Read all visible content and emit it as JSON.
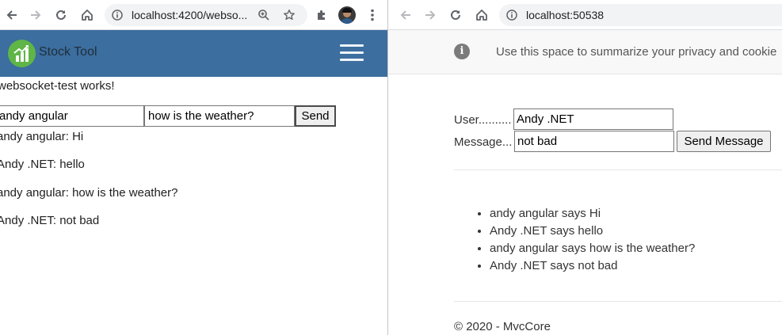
{
  "left": {
    "browser": {
      "url": "localhost:4200/webso..."
    },
    "navbar": {
      "brand": "Stock Tool"
    },
    "heading": "websocket-test works!",
    "form": {
      "user_value": "andy angular",
      "message_value": "how is the weather?",
      "send_label": "Send"
    },
    "messages": [
      "andy angular: Hi",
      "Andy .NET: hello",
      "andy angular: how is the weather?",
      "Andy .NET: not bad"
    ]
  },
  "right": {
    "browser": {
      "url": "localhost:50538"
    },
    "privacy": {
      "text": "Use this space to summarize your privacy and cookie"
    },
    "form": {
      "user_label": "User..........",
      "user_value": "Andy .NET",
      "message_label": "Message...",
      "message_value": "not bad",
      "send_label": "Send Message"
    },
    "messages": [
      "andy angular says Hi",
      "Andy .NET says hello",
      "andy angular says how is the weather?",
      "Andy .NET says not bad"
    ],
    "footer": "© 2020 - MvcCore"
  },
  "colors": {
    "navbar": "#3c6e9f",
    "logo": "#5fb646",
    "toolbar": "#ffffff",
    "omnibox": "#f1f3f4"
  }
}
